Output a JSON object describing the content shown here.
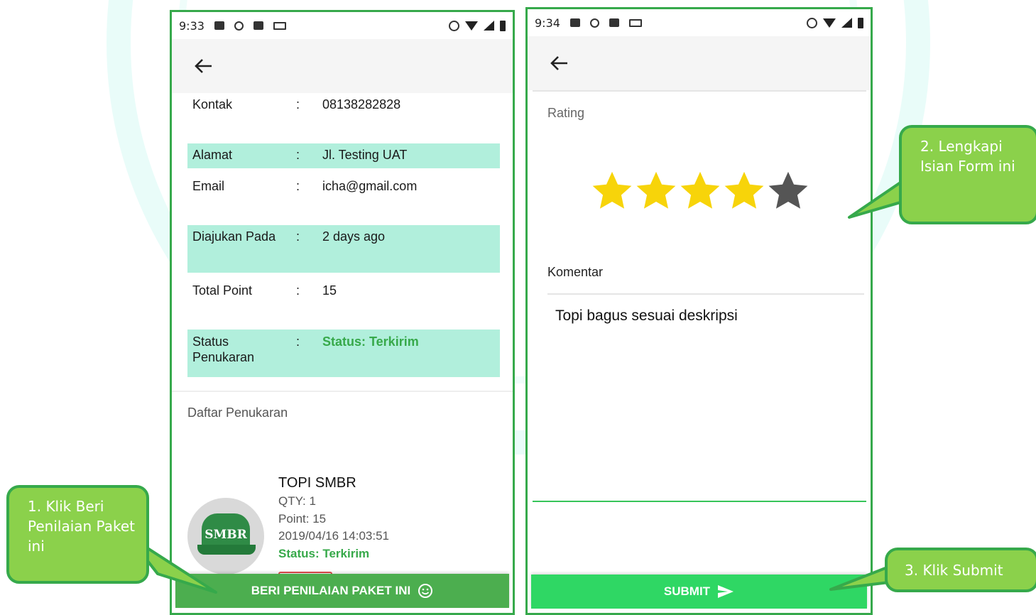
{
  "screen1": {
    "status_time": "9:33",
    "details": [
      {
        "label": "Kontak",
        "value": "08138282828",
        "highlight": false
      },
      {
        "label": "Alamat",
        "value": "Jl. Testing UAT",
        "highlight": true
      },
      {
        "label": "Email",
        "value": "icha@gmail.com",
        "highlight": false
      },
      {
        "label": "Diajukan Pada",
        "value": "2 days ago",
        "highlight": true
      },
      {
        "label": "Total Point",
        "value": "15",
        "highlight": false
      },
      {
        "label": "Status Penukaran",
        "value": "Status: Terkirim",
        "highlight": true
      }
    ],
    "colon": ":",
    "section_title": "Daftar Penukaran",
    "item": {
      "name": "TOPI SMBR",
      "qty": "QTY: 1",
      "point": "Point: 15",
      "date": "2019/04/16 14:03:51",
      "status": "Status: Terkirim",
      "logo_text": "SMBR"
    },
    "rate_button": "BERI PENILAIAN PAKET INI",
    "rate_button_icon": "smiley-icon"
  },
  "screen2": {
    "status_time": "9:34",
    "rating_label": "Rating",
    "rating_value": 4,
    "rating_max": 5,
    "comment_label": "Komentar",
    "comment_value": "Topi bagus sesuai deskripsi",
    "submit_button": "SUBMIT",
    "submit_button_icon": "send-icon"
  },
  "callouts": {
    "step1": "1. Klik Beri Penilaian Paket ini",
    "step2": "2. Lengkapi Isian Form ini",
    "step3": "3. Klik Submit"
  },
  "colors": {
    "frame_green": "#36a94b",
    "highlight_row": "#b1efdc",
    "status_green": "#37a94a",
    "rate_button": "#4cae4f",
    "submit_button": "#2fd764",
    "callout_fill": "#8bd14b",
    "star_filled": "#f7d40a",
    "star_empty": "#555555"
  }
}
